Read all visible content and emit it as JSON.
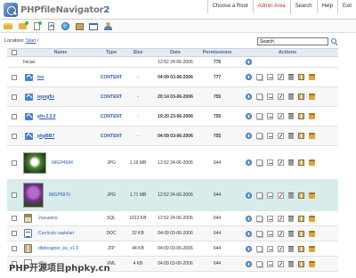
{
  "app": {
    "logo_text": "PHPfileNavigator",
    "logo_version": "2"
  },
  "topnav": [
    "Choose a Root",
    "Admin Area",
    "Search",
    "Help",
    "Exit"
  ],
  "toolbar": {
    "icons": [
      "open-folder-icon",
      "new-folder-icon",
      "new-file-icon",
      "upload-icon",
      "globe-icon",
      "archive-icon",
      "window-icon",
      "users-icon"
    ]
  },
  "location": {
    "label": "Location:",
    "path": "Start",
    "sep": "/"
  },
  "search": {
    "value": "Search"
  },
  "table": {
    "headers": {
      "name": "Name",
      "type": "Type",
      "size": "Size",
      "date": "Date",
      "permissions": "Permissions",
      "actions": "Actions"
    },
    "rows": [
      {
        "name": "Inicial",
        "type": "",
        "size": "",
        "date": "12:52 24-06-2006",
        "perm": "775",
        "kind": "root"
      },
      {
        "name": "ico",
        "type": "CONTENT",
        "size": "-",
        "date": "04:09 03-06-2006",
        "perm": "777",
        "kind": "dir"
      },
      {
        "name": "iepngfix",
        "type": "CONTENT",
        "size": "-",
        "date": "20:14 03-06-2006",
        "perm": "755",
        "kind": "dir"
      },
      {
        "name": "pfn-2.3.0",
        "type": "CONTENT",
        "size": "-",
        "date": "19:20 23-06-2006",
        "perm": "755",
        "kind": "dir"
      },
      {
        "name": "phpBB7",
        "type": "CONTENT",
        "size": "-",
        "date": "04:09 03-06-2006",
        "perm": "755",
        "kind": "dir"
      },
      {
        "name": "IMGP4584",
        "type": "JPG",
        "size": "1.16 MB",
        "date": "12:52 24-06-2006",
        "perm": "644",
        "kind": "img1"
      },
      {
        "name": "IMGP5870",
        "type": "JPG",
        "size": "1.71 MB",
        "date": "12:52 24-06-2006",
        "perm": "644",
        "kind": "img2"
      },
      {
        "name": "2usuarios",
        "type": "SQL",
        "size": "1012 KB",
        "date": "12:52 24-06-2006",
        "perm": "644",
        "kind": "sql"
      },
      {
        "name": "Curriculo castelan",
        "type": "DOC",
        "size": "32 KB",
        "date": "04:09 03-06-2006",
        "perm": "644",
        "kind": "doc"
      },
      {
        "name": "dbdesigner_es_v1.9",
        "type": "ZIP",
        "size": "44 KB",
        "date": "04:09 03-06-2006",
        "perm": "644",
        "kind": "zip"
      },
      {
        "name": "dfile",
        "type": "XML",
        "size": "4 KB",
        "date": "04:09 03-06-2006",
        "perm": "644",
        "kind": "xml"
      }
    ]
  },
  "watermark": "PHP开源项目phpky.cn"
}
